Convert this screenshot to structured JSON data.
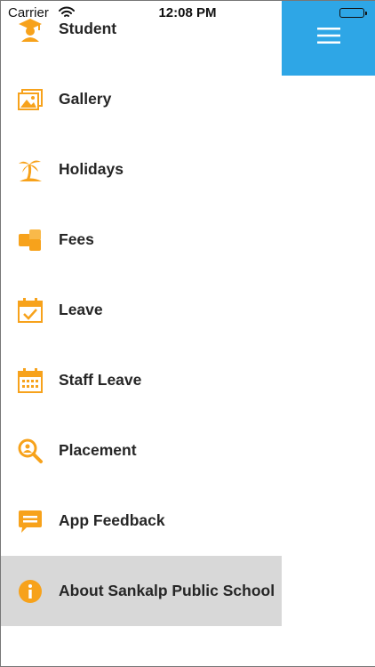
{
  "status_bar": {
    "carrier": "Carrier",
    "time": "12:08 PM"
  },
  "menu": {
    "items": [
      {
        "label": "Student",
        "icon": "graduation-student-icon"
      },
      {
        "label": "Gallery",
        "icon": "gallery-icon"
      },
      {
        "label": "Holidays",
        "icon": "palm-tree-icon"
      },
      {
        "label": "Fees",
        "icon": "fees-icon"
      },
      {
        "label": "Leave",
        "icon": "calendar-check-icon"
      },
      {
        "label": "Staff Leave",
        "icon": "calendar-grid-icon"
      },
      {
        "label": "Placement",
        "icon": "placement-search-icon"
      },
      {
        "label": "App Feedback",
        "icon": "feedback-chat-icon"
      },
      {
        "label": "About Sankalp Public School",
        "icon": "info-icon",
        "selected": true
      }
    ]
  },
  "header": {
    "menu_icon": "hamburger-menu-icon"
  },
  "colors": {
    "accent_blue": "#2ea6e6",
    "icon_orange": "#f7a21b",
    "selected_bg": "#d8d8d8"
  }
}
